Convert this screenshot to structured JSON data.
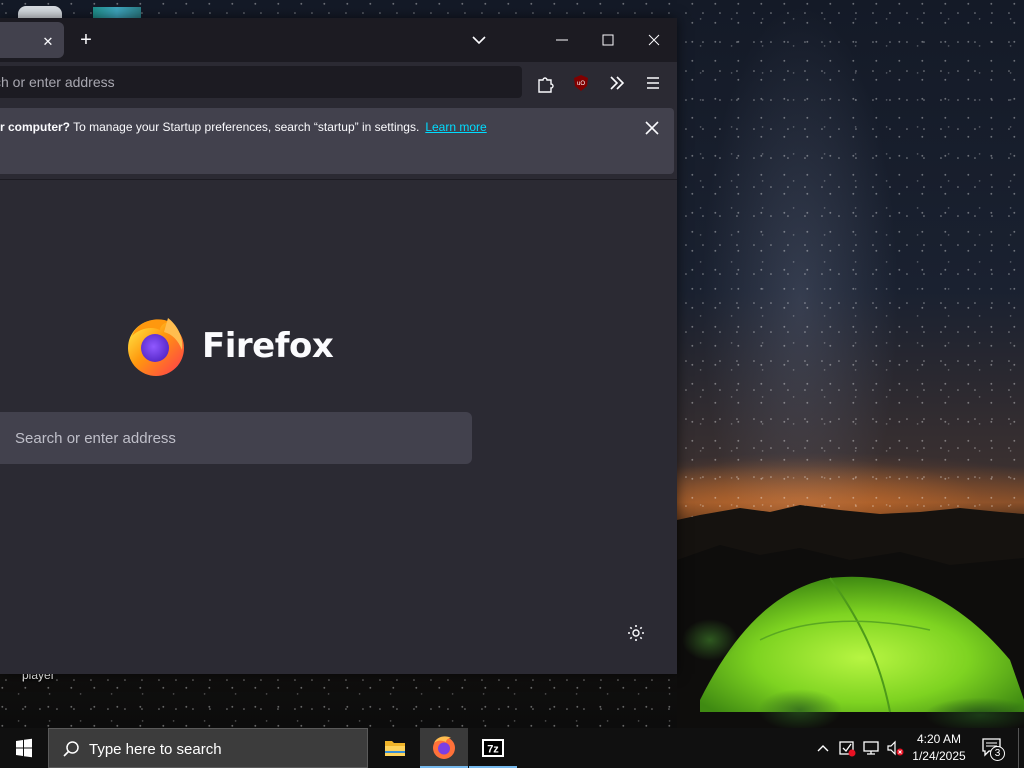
{
  "desktop": {
    "icon_label": "player"
  },
  "browser": {
    "tab": {
      "close_glyph": "✕"
    },
    "new_tab_glyph": "+",
    "address_bar": {
      "placeholder": "Search or enter address",
      "visible_placeholder": "ch or enter address"
    },
    "toolbar_icons": [
      "extensions-icon",
      "ublock-origin-icon",
      "overflow-chevron-icon",
      "hamburger-menu-icon"
    ],
    "window_controls": [
      "minimize-icon",
      "maximize-icon",
      "close-icon"
    ],
    "notification": {
      "bold_text": "r computer?",
      "text": " To manage your Startup preferences, search “startup” in settings.",
      "link": "Learn more"
    },
    "newtab": {
      "brand": "Firefox",
      "search_placeholder": "Search or enter address"
    }
  },
  "taskbar": {
    "search_placeholder": "Type here to search",
    "pinned_apps": [
      "file-explorer-icon",
      "firefox-icon",
      "7zip-icon"
    ],
    "clock": {
      "time": "4:20 AM",
      "date": "1/24/2025"
    },
    "notification_count": "3"
  },
  "colors": {
    "tabbar": "#1c1b22",
    "toolbar": "#2b2a33",
    "panel": "#42414d",
    "link": "#00ddff",
    "taskbar": "#101010",
    "tent_green": "#7ed321"
  }
}
